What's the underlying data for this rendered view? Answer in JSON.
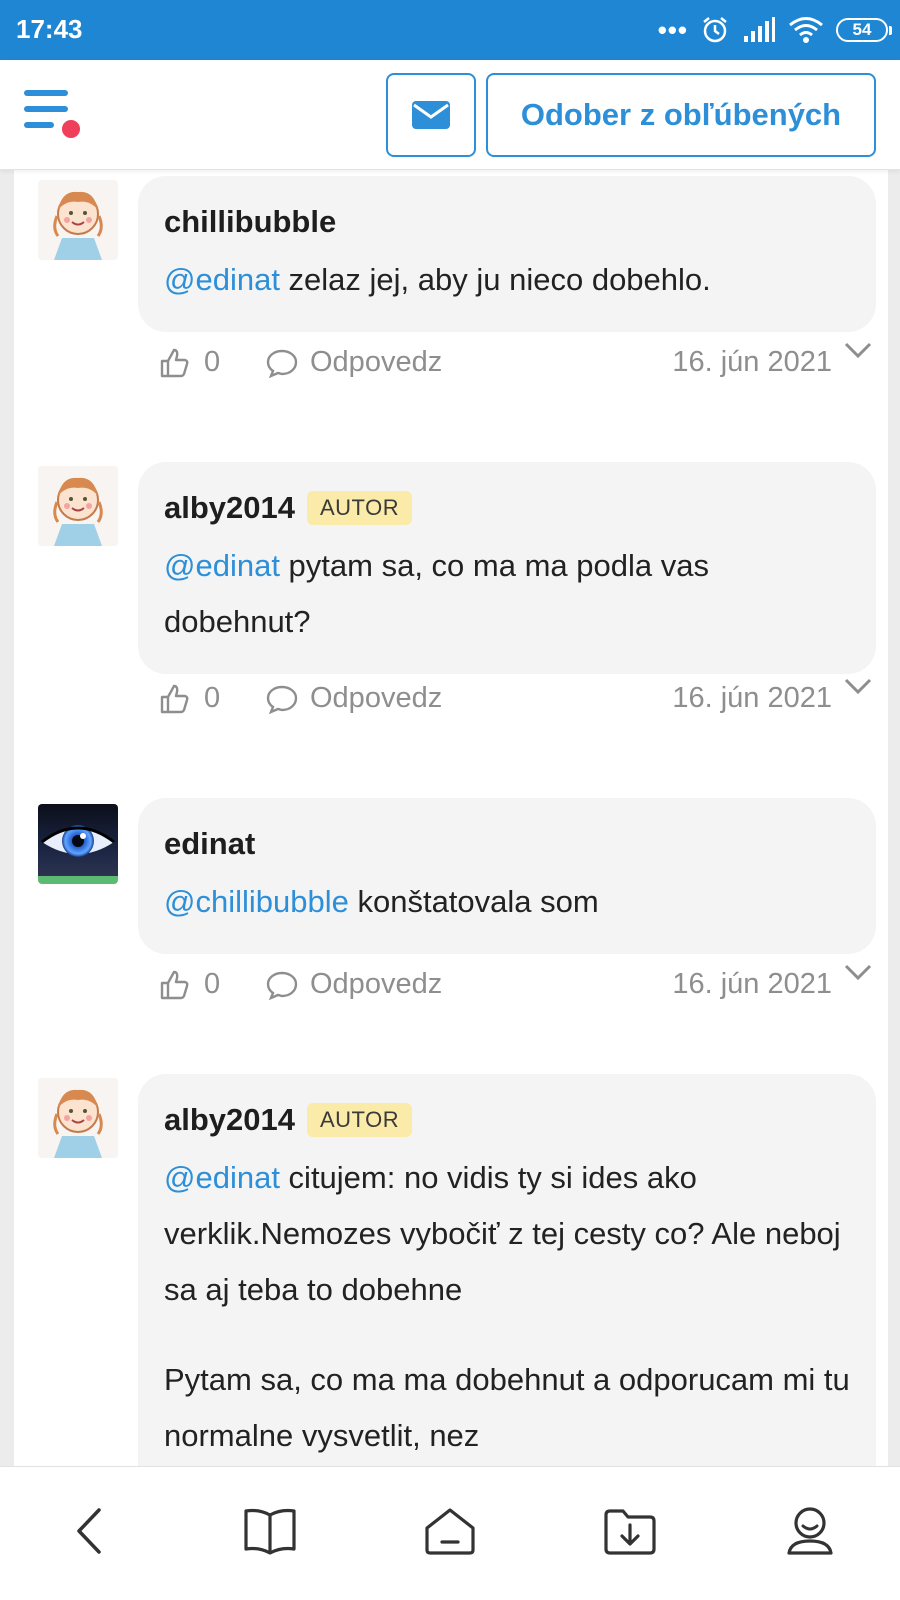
{
  "status_bar": {
    "time": "17:43",
    "dots": "•••",
    "battery": "54"
  },
  "header": {
    "menu_icon": "menu-icon",
    "mail_icon": "envelope-icon",
    "favorite_button": "Odober z obľúbených",
    "accent_color": "#2d8fd8",
    "notification_color": "#f03f5b"
  },
  "comments": [
    {
      "author": "chillibubble",
      "badge": "",
      "mention": "@edinat",
      "text": " zelaz jej, aby ju nieco dobehlo.",
      "likes": "0",
      "reply": "Odpovedz",
      "date": "16. jún 2021"
    },
    {
      "author": "alby2014",
      "badge": "AUTOR",
      "mention": "@edinat",
      "text": " pytam sa, co ma ma podla vas dobehnut?",
      "likes": "0",
      "reply": "Odpovedz",
      "date": "16. jún 2021"
    },
    {
      "author": "edinat",
      "badge": "",
      "mention": "@chillibubble",
      "text": " konštatovala som",
      "likes": "0",
      "reply": "Odpovedz",
      "date": "16. jún 2021"
    },
    {
      "author": "alby2014",
      "badge": "AUTOR",
      "mention": "@edinat",
      "text": " citujem: no vidis ty si ides ako verklik.Nemozes vybočiť z tej cesty co? Ale neboj sa aj teba to dobehne",
      "text2": "Pytam sa, co ma ma dobehnut a odporucam mi tu normalne vysvetlit, nez"
    }
  ],
  "bottom_nav": [
    "back-icon",
    "book-icon",
    "home-icon",
    "download-folder-icon",
    "profile-icon"
  ]
}
